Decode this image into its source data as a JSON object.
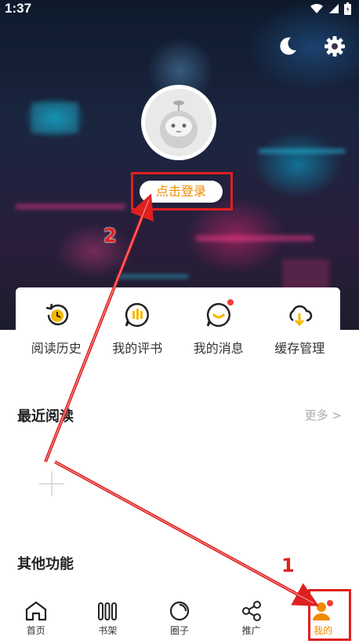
{
  "status_bar": {
    "time": "1:37"
  },
  "header": {
    "theme_icon": "moon-icon",
    "settings_icon": "gear-icon"
  },
  "profile": {
    "login_label": "点击登录"
  },
  "quick_actions": [
    {
      "label": "阅读历史",
      "icon": "history-icon"
    },
    {
      "label": "我的评书",
      "icon": "chat-bars-icon"
    },
    {
      "label": "我的消息",
      "icon": "message-icon"
    },
    {
      "label": "缓存管理",
      "icon": "cloud-download-icon"
    }
  ],
  "recent": {
    "title": "最近阅读",
    "more_label": "更多 >"
  },
  "other": {
    "title": "其他功能"
  },
  "bottom_nav": [
    {
      "label": "首页",
      "icon": "home-icon"
    },
    {
      "label": "书架",
      "icon": "bookshelf-icon"
    },
    {
      "label": "圈子",
      "icon": "circle-icon"
    },
    {
      "label": "推广",
      "icon": "share-icon"
    },
    {
      "label": "我的",
      "icon": "person-icon"
    }
  ],
  "annotations": {
    "step1": "1",
    "step2": "2"
  },
  "colors": {
    "accent": "#f08a00",
    "annotation": "#e02020"
  }
}
